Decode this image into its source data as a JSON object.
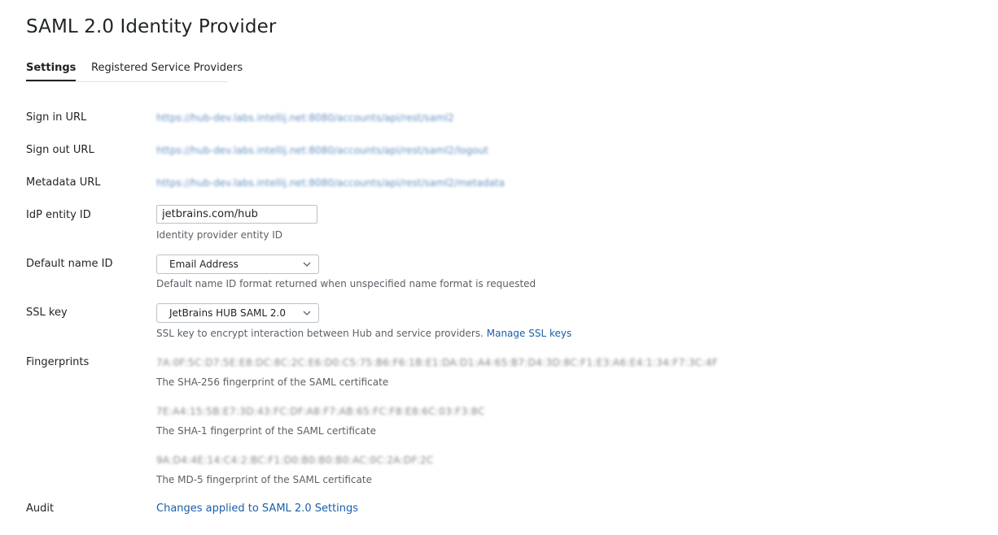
{
  "page": {
    "title": "SAML 2.0 Identity Provider"
  },
  "tabs": [
    {
      "label": "Settings",
      "active": true
    },
    {
      "label": "Registered Service Providers",
      "active": false
    }
  ],
  "fields": {
    "sign_in_url": {
      "label": "Sign in URL",
      "value": "https://hub-dev.labs.intellij.net:8080/accounts/api/rest/saml2"
    },
    "sign_out_url": {
      "label": "Sign out URL",
      "value": "https://hub-dev.labs.intellij.net:8080/accounts/api/rest/saml2/logout"
    },
    "metadata_url": {
      "label": "Metadata URL",
      "value": "https://hub-dev.labs.intellij.net:8080/accounts/api/rest/saml2/metadata"
    },
    "idp_entity_id": {
      "label": "IdP entity ID",
      "value": "jetbrains.com/hub",
      "hint": "Identity provider entity ID"
    },
    "default_name_id": {
      "label": "Default name ID",
      "value": "Email Address",
      "hint": "Default name ID format returned when unspecified name format is requested"
    },
    "ssl_key": {
      "label": "SSL key",
      "value": "JetBrains HUB SAML 2.0",
      "hint": "SSL key to encrypt interaction between Hub and service providers.",
      "link": "Manage SSL keys"
    },
    "fingerprints": {
      "label": "Fingerprints",
      "sha256": {
        "value": "7A:0F:5C:D7:5E:E8:DC:8C:2C:E6:D0:C5:75:B6:F6:1B:E1:DA:D1:A4:65:B7:D4:3D:8C:F1:E3:A6:E4:1:34:F7:3C:4F",
        "hint": "The SHA-256 fingerprint of the SAML certificate"
      },
      "sha1": {
        "value": "7E:A4:15:5B:E7:3D:43:FC:DF:A8:F7:AB:65:FC:F8:E8:6C:03:F3:8C",
        "hint": "The SHA-1 fingerprint of the SAML certificate"
      },
      "md5": {
        "value": "9A:D4:4E:14:C4:2:BC:F1:D0:B0:B0:B0:AC:0C:2A:DF:2C",
        "hint": "The MD-5 fingerprint of the SAML certificate"
      }
    },
    "audit": {
      "label": "Audit",
      "link": "Changes applied to SAML 2.0 Settings"
    }
  },
  "icons": {
    "dropdown": "chevron-down-icon"
  },
  "colors": {
    "link": "#1a5fa8",
    "text": "#1f2326",
    "hint": "#5c6066",
    "border": "#b9c1c9"
  }
}
